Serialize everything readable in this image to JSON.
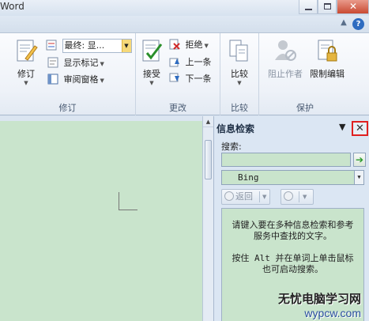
{
  "window": {
    "title_fragment": "Word"
  },
  "ribbon": {
    "track_group": {
      "label": "修订",
      "track_button": "修订",
      "display_combo": "最终: 显...",
      "show_markup": "显示标记",
      "reviewing_pane": "审阅窗格"
    },
    "changes_group": {
      "label": "更改",
      "accept": "接受",
      "reject": "拒绝",
      "previous": "上一条",
      "next": "下一条"
    },
    "compare_group": {
      "label": "比较",
      "compare": "比较"
    },
    "protect_group": {
      "label": "保护",
      "block_authors": "阻止作者",
      "restrict_editing": "限制编辑"
    }
  },
  "research_pane": {
    "title": "信息检索",
    "search_label": "搜索:",
    "search_value": "",
    "source": "Bing",
    "back": "返回",
    "help_text_1": "请键入要在多种信息检索和参考服务中查找的文字。",
    "help_text_2": "按住 Alt 并在单词上单击鼠标也可启动搜索。"
  },
  "watermark": {
    "line1": "无忧电脑学习网",
    "line2": "wypcw.com"
  },
  "colors": {
    "doc_bg": "#c9e4cc",
    "close_highlight": "#e02020",
    "ribbon_bg": "#eef2f8"
  }
}
